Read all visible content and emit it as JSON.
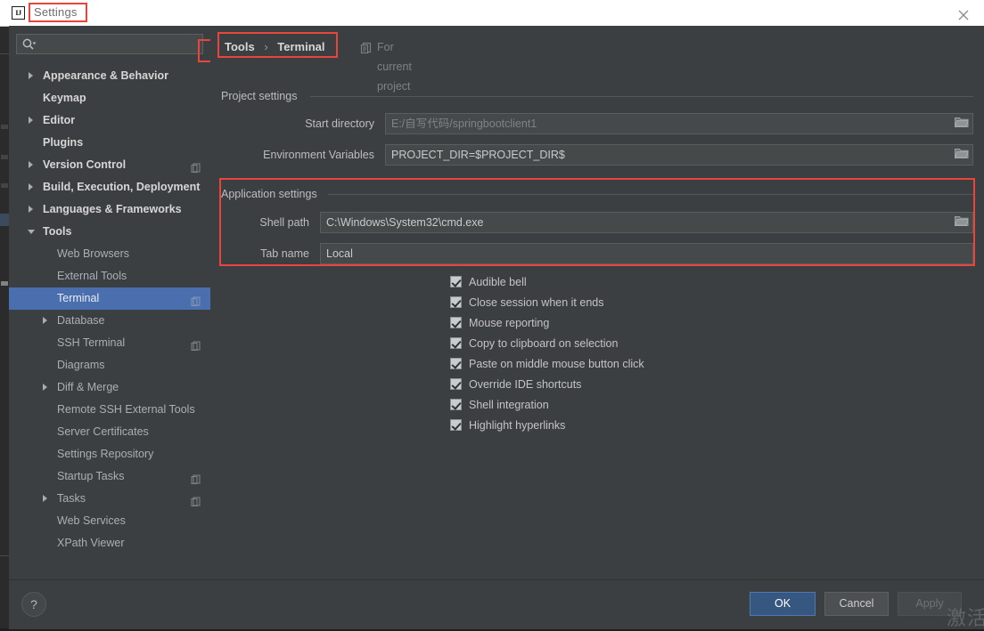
{
  "window": {
    "title": "Settings",
    "logo_text": "IJ",
    "close_icon": "close-icon"
  },
  "search": {
    "value": "",
    "placeholder": "",
    "icon": "search-icon"
  },
  "sidebar": {
    "items": [
      {
        "label": "Appearance & Behavior",
        "level": "top",
        "arrow": "collapsed",
        "config_icon": false
      },
      {
        "label": "Keymap",
        "level": "top",
        "arrow": "none",
        "config_icon": false
      },
      {
        "label": "Editor",
        "level": "top",
        "arrow": "collapsed",
        "config_icon": false
      },
      {
        "label": "Plugins",
        "level": "top",
        "arrow": "none",
        "config_icon": false
      },
      {
        "label": "Version Control",
        "level": "top",
        "arrow": "collapsed",
        "config_icon": true
      },
      {
        "label": "Build, Execution, Deployment",
        "level": "top",
        "arrow": "collapsed",
        "config_icon": false
      },
      {
        "label": "Languages & Frameworks",
        "level": "top",
        "arrow": "collapsed",
        "config_icon": false
      },
      {
        "label": "Tools",
        "level": "top",
        "arrow": "expanded",
        "config_icon": false
      },
      {
        "label": "Web Browsers",
        "level": "child",
        "arrow": "none",
        "config_icon": false
      },
      {
        "label": "External Tools",
        "level": "child",
        "arrow": "none",
        "config_icon": false
      },
      {
        "label": "Terminal",
        "level": "child",
        "arrow": "none",
        "config_icon": true,
        "selected": true
      },
      {
        "label": "Database",
        "level": "child",
        "arrow": "collapsed",
        "config_icon": false
      },
      {
        "label": "SSH Terminal",
        "level": "child",
        "arrow": "none",
        "config_icon": true
      },
      {
        "label": "Diagrams",
        "level": "child",
        "arrow": "none",
        "config_icon": false
      },
      {
        "label": "Diff & Merge",
        "level": "child",
        "arrow": "collapsed",
        "config_icon": false
      },
      {
        "label": "Remote SSH External Tools",
        "level": "child",
        "arrow": "none",
        "config_icon": false
      },
      {
        "label": "Server Certificates",
        "level": "child",
        "arrow": "none",
        "config_icon": false
      },
      {
        "label": "Settings Repository",
        "level": "child",
        "arrow": "none",
        "config_icon": false
      },
      {
        "label": "Startup Tasks",
        "level": "child",
        "arrow": "none",
        "config_icon": true
      },
      {
        "label": "Tasks",
        "level": "child",
        "arrow": "collapsed",
        "config_icon": true
      },
      {
        "label": "Web Services",
        "level": "child",
        "arrow": "none",
        "config_icon": false
      },
      {
        "label": "XPath Viewer",
        "level": "child",
        "arrow": "none",
        "config_icon": false
      }
    ]
  },
  "content": {
    "breadcrumb": {
      "parent": "Tools",
      "separator": "›",
      "current": "Terminal"
    },
    "scope_note": {
      "label": "For current project",
      "icon": "copy-icon"
    },
    "project_settings": {
      "title": "Project settings",
      "fields": [
        {
          "label": "Start directory",
          "value": "E:/自写代码/springbootclient1",
          "dim": true,
          "browse": true
        },
        {
          "label": "Environment Variables",
          "value": "PROJECT_DIR=$PROJECT_DIR$",
          "dim": false,
          "browse": true
        }
      ]
    },
    "application_settings": {
      "title": "Application settings",
      "fields": [
        {
          "label": "Shell path",
          "value": "C:\\Windows\\System32\\cmd.exe",
          "dim": false,
          "browse": true
        },
        {
          "label": "Tab name",
          "value": "Local",
          "dim": false,
          "browse": false
        }
      ],
      "checkboxes": [
        {
          "label": "Audible bell",
          "checked": true
        },
        {
          "label": "Close session when it ends",
          "checked": true
        },
        {
          "label": "Mouse reporting",
          "checked": true
        },
        {
          "label": "Copy to clipboard on selection",
          "checked": true
        },
        {
          "label": "Paste on middle mouse button click",
          "checked": true
        },
        {
          "label": "Override IDE shortcuts",
          "checked": true
        },
        {
          "label": "Shell integration",
          "checked": true
        },
        {
          "label": "Highlight hyperlinks",
          "checked": true
        }
      ]
    }
  },
  "footer": {
    "help_label": "?",
    "buttons": [
      {
        "label": "OK",
        "style": "primary"
      },
      {
        "label": "Cancel",
        "style": "normal"
      },
      {
        "label": "Apply",
        "style": "disabled"
      }
    ]
  },
  "watermark": {
    "text": "激活"
  },
  "colors": {
    "dialog_bg": "#3c3f41",
    "field_bg": "#45494a",
    "selection_blue": "#4b6eaf",
    "primary_button": "#365880",
    "highlight_red": "#e8453c",
    "titlebar_bg": "#ffffff"
  }
}
